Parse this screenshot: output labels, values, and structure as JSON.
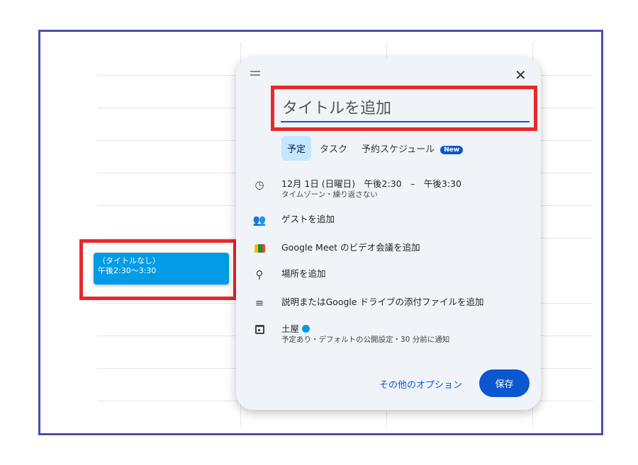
{
  "event": {
    "title": "（タイトルなし）",
    "time": "午後2:30～3:30"
  },
  "dialog": {
    "title_placeholder": "タイトルを追加",
    "tabs": [
      {
        "label": "予定",
        "active": true
      },
      {
        "label": "タスク",
        "active": false
      },
      {
        "label": "予約スケジュール",
        "active": false,
        "badge": "New"
      }
    ],
    "datetime": {
      "main": "12月 1日 (日曜日)　午後2:30　–　午後3:30",
      "sub": "タイムゾーン・繰り返さない"
    },
    "guests_label": "ゲストを追加",
    "meet_label": "Google Meet のビデオ会議を追加",
    "location_label": "場所を追加",
    "description_label": "説明またはGoogle ドライブの添付ファイルを追加",
    "calendar": {
      "name": "土屋",
      "sub": "予定あり・デフォルトの公開設定・30 分前に通知",
      "color": "#039be5"
    },
    "more_options_label": "その他のオプション",
    "save_label": "保存"
  },
  "icons": {
    "drag": "drag-handle-icon",
    "close": "close-icon",
    "clock": "clock-icon",
    "guests": "people-icon",
    "meet": "google-meet-icon",
    "location": "location-pin-icon",
    "description": "notes-icon",
    "calendar": "calendar-icon"
  },
  "colors": {
    "accent": "#0b57d0",
    "event": "#039be5",
    "highlight": "#e8282b",
    "frame": "#4a4fb0"
  }
}
